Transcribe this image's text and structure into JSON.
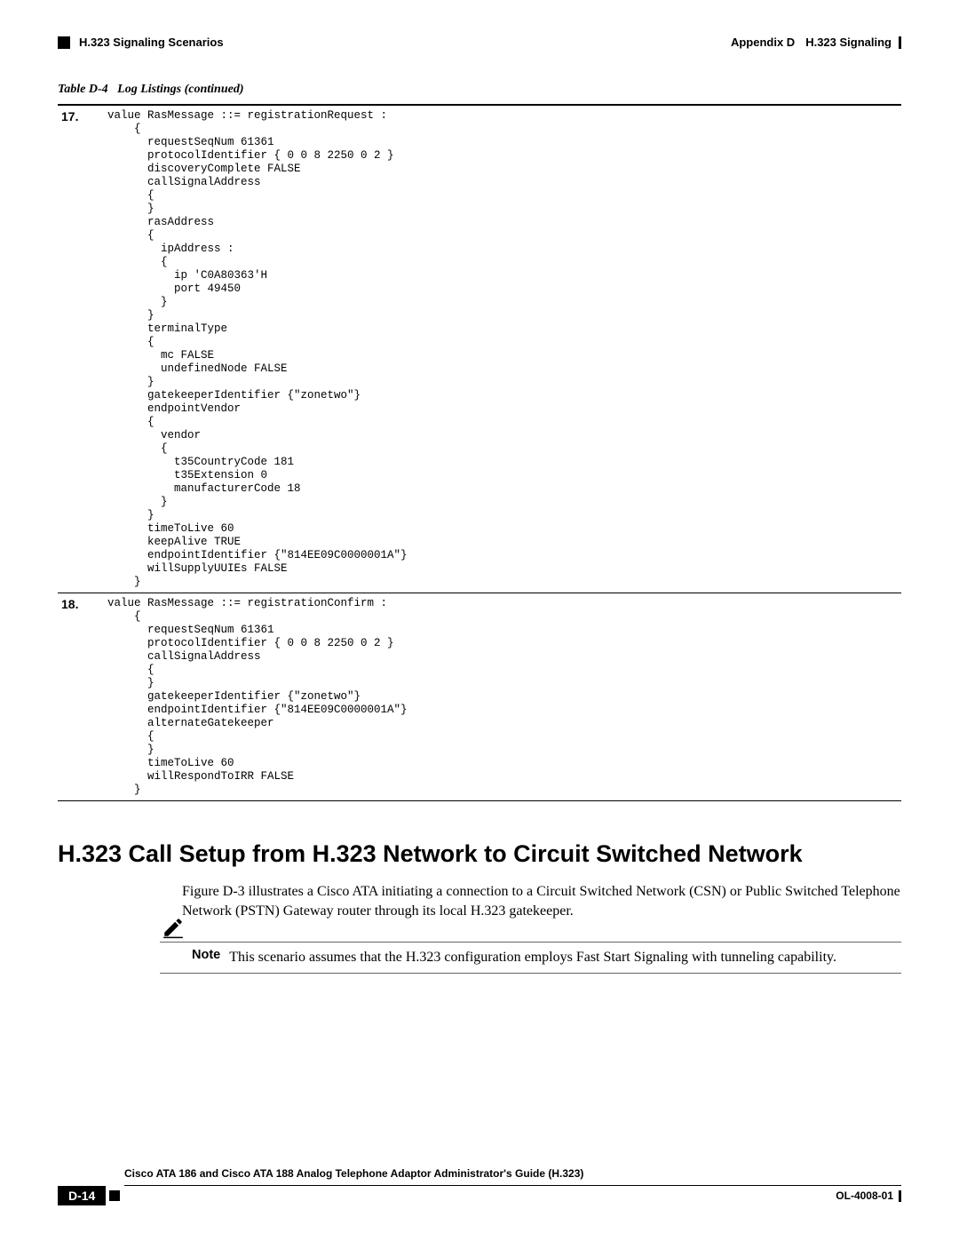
{
  "header": {
    "left_section": "H.323 Signaling Scenarios",
    "right_appendix": "Appendix D",
    "right_title": "H.323 Signaling"
  },
  "table": {
    "caption_label": "Table D-4",
    "caption_title": "Log Listings (continued)",
    "rows": [
      {
        "num": "17.",
        "code": "value RasMessage ::= registrationRequest :\n    {\n      requestSeqNum 61361\n      protocolIdentifier { 0 0 8 2250 0 2 }\n      discoveryComplete FALSE\n      callSignalAddress\n      {\n      }\n      rasAddress\n      {\n        ipAddress :\n        {\n          ip 'C0A80363'H\n          port 49450\n        }\n      }\n      terminalType\n      {\n        mc FALSE\n        undefinedNode FALSE\n      }\n      gatekeeperIdentifier {\"zonetwo\"}\n      endpointVendor\n      {\n        vendor\n        {\n          t35CountryCode 181\n          t35Extension 0\n          manufacturerCode 18\n        }\n      }\n      timeToLive 60\n      keepAlive TRUE\n      endpointIdentifier {\"814EE09C0000001A\"}\n      willSupplyUUIEs FALSE\n    }"
      },
      {
        "num": "18.",
        "code": "value RasMessage ::= registrationConfirm :\n    {\n      requestSeqNum 61361\n      protocolIdentifier { 0 0 8 2250 0 2 }\n      callSignalAddress\n      {\n      }\n      gatekeeperIdentifier {\"zonetwo\"}\n      endpointIdentifier {\"814EE09C0000001A\"}\n      alternateGatekeeper\n      {\n      }\n      timeToLive 60\n      willRespondToIRR FALSE\n    }"
      }
    ]
  },
  "section_heading": "H.323 Call Setup from H.323 Network to Circuit Switched Network",
  "body_paragraph": "Figure D-3 illustrates a Cisco ATA initiating a connection to a Circuit Switched Network (CSN) or Public Switched Telephone Network (PSTN) Gateway router through its local H.323 gatekeeper.",
  "note": {
    "label": "Note",
    "text": "This scenario assumes that the H.323 configuration employs Fast Start Signaling with tunneling capability."
  },
  "footer": {
    "book_title": "Cisco ATA 186 and Cisco ATA 188 Analog Telephone Adaptor Administrator's Guide (H.323)",
    "page_badge": "D-14",
    "doc_id": "OL-4008-01"
  }
}
